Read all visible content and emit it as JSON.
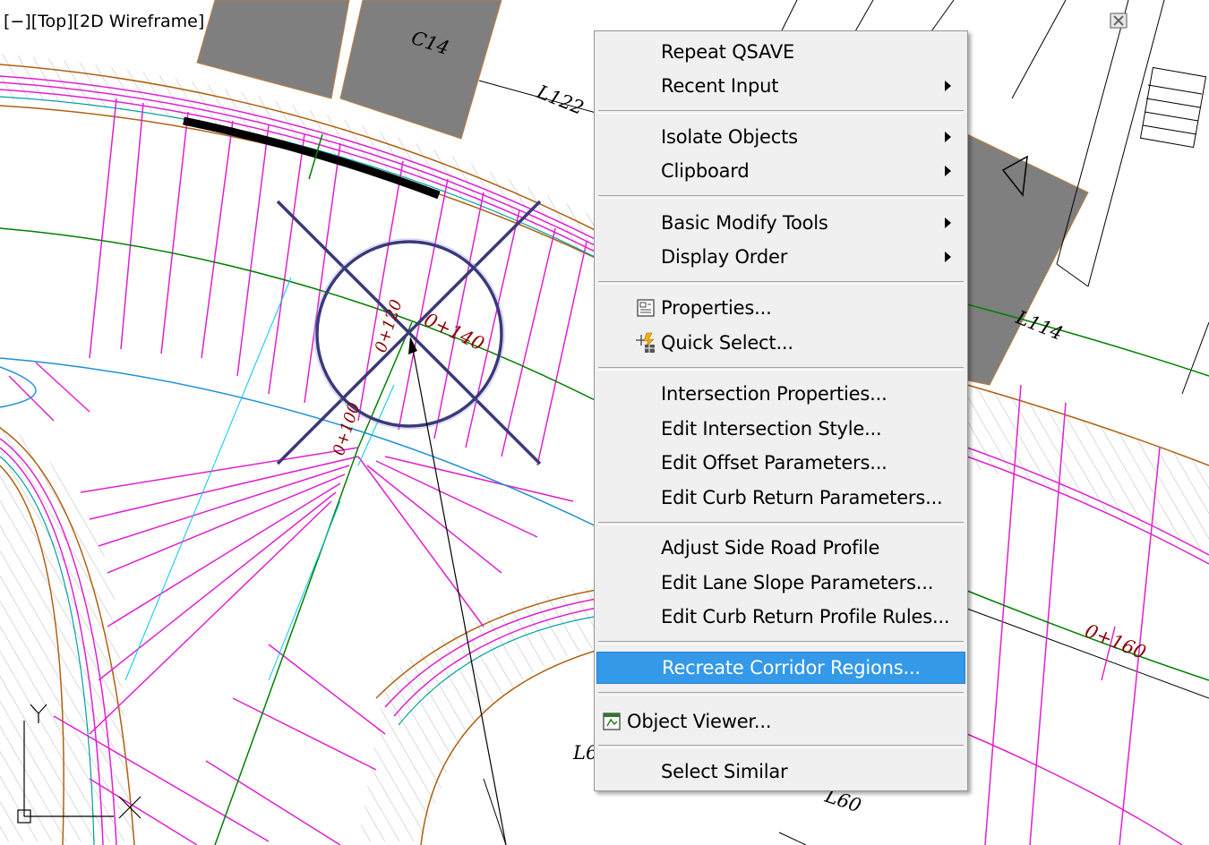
{
  "viewport": {
    "label": "[−][Top][2D Wireframe]",
    "labels": {
      "parcel_c14": "C14",
      "line_l122": "L122",
      "line_l114": "L114",
      "line_l6": "L6",
      "line_l60": "L60",
      "station_0140": "0+140",
      "station_0160": "0+160",
      "station_0120": "0+120",
      "station_0100": "0+100"
    },
    "colors": {
      "corridor_lines": "#e020d0",
      "alignment_green": "#008000",
      "offset_blue": "#1e90d8",
      "cyan": "#00c8f0",
      "parcel_gray": "#7f7f7f",
      "station_text": "#8b0000",
      "curb_brown": "#b06010"
    }
  },
  "window_controls": {
    "minimize": "minimize-icon",
    "restore": "restore-icon",
    "close": "close-icon"
  },
  "context_menu": {
    "items": [
      {
        "label": "Repeat QSAVE"
      },
      {
        "label": "Recent Input"
      },
      {
        "label": "Isolate Objects"
      },
      {
        "label": "Clipboard"
      },
      {
        "label": "Basic Modify Tools"
      },
      {
        "label": "Display Order"
      },
      {
        "label": "Properties..."
      },
      {
        "label": "Quick Select..."
      },
      {
        "label": "Intersection Properties..."
      },
      {
        "label": "Edit Intersection Style..."
      },
      {
        "label": "Edit Offset Parameters..."
      },
      {
        "label": "Edit Curb Return Parameters..."
      },
      {
        "label": "Adjust Side Road Profile"
      },
      {
        "label": "Edit Lane Slope Parameters..."
      },
      {
        "label": "Edit Curb Return Profile Rules..."
      },
      {
        "label": "Recreate Corridor Regions..."
      },
      {
        "label": "Object Viewer..."
      },
      {
        "label": "Select Similar"
      }
    ],
    "highlight_color": "#3399e8"
  },
  "ucs": {
    "x_label": "X",
    "y_label": "Y"
  }
}
